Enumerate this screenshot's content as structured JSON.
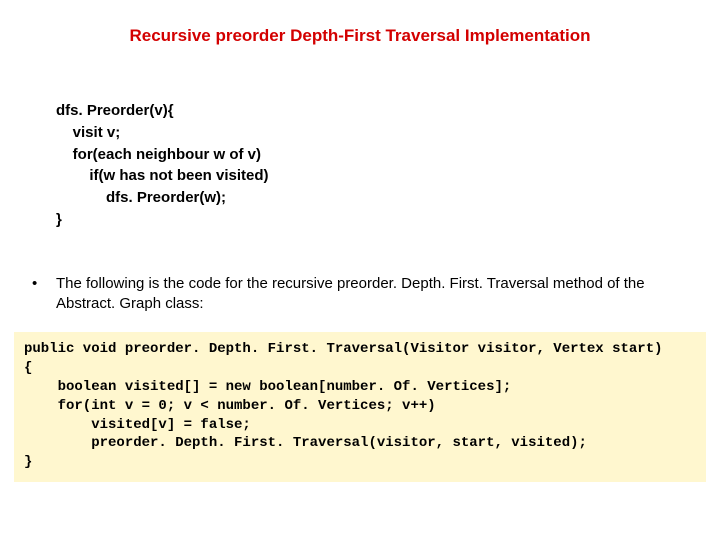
{
  "title": "Recursive preorder Depth-First Traversal Implementation",
  "pseudo": "dfs. Preorder(v){\n    visit v;\n    for(each neighbour w of v)\n        if(w has not been visited)\n            dfs. Preorder(w);\n}",
  "bullet": {
    "mark": "•",
    "text": "The following is the code for the recursive preorder. Depth. First. Traversal method of the Abstract. Graph class:"
  },
  "code": "public void preorder. Depth. First. Traversal(Visitor visitor, Vertex start)\n{\n    boolean visited[] = new boolean[number. Of. Vertices];\n    for(int v = 0; v < number. Of. Vertices; v++)\n        visited[v] = false;\n        preorder. Depth. First. Traversal(visitor, start, visited);\n}"
}
